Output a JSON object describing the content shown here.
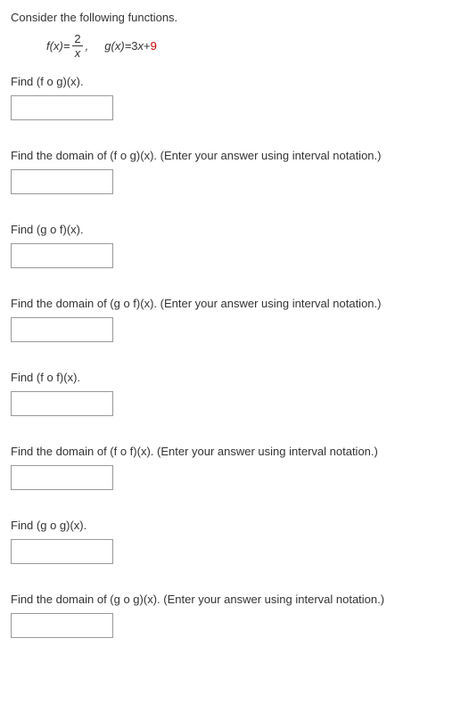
{
  "intro": "Consider the following functions.",
  "f_label": "f",
  "g_label": "g",
  "x_label": "x",
  "eq": " = ",
  "open_paren": "(",
  "close_paren": ")",
  "frac_num": "2",
  "frac_den": "x",
  "comma": ",",
  "g_expr_prefix": "3",
  "g_expr_mid": " + ",
  "g_expr_const": "9",
  "prompts": {
    "p1": "Find (f o g)(x).",
    "p2": "Find the domain of (f o g)(x). (Enter your answer using interval notation.)",
    "p3": "Find (g o f)(x).",
    "p4": "Find the domain of (g o f)(x). (Enter your answer using interval notation.)",
    "p5": "Find (f o f)(x).",
    "p6": "Find the domain of (f o f)(x). (Enter your answer using interval notation.)",
    "p7": "Find (g o g)(x).",
    "p8": "Find the domain of (g o g)(x). (Enter your answer using interval notation.)"
  }
}
